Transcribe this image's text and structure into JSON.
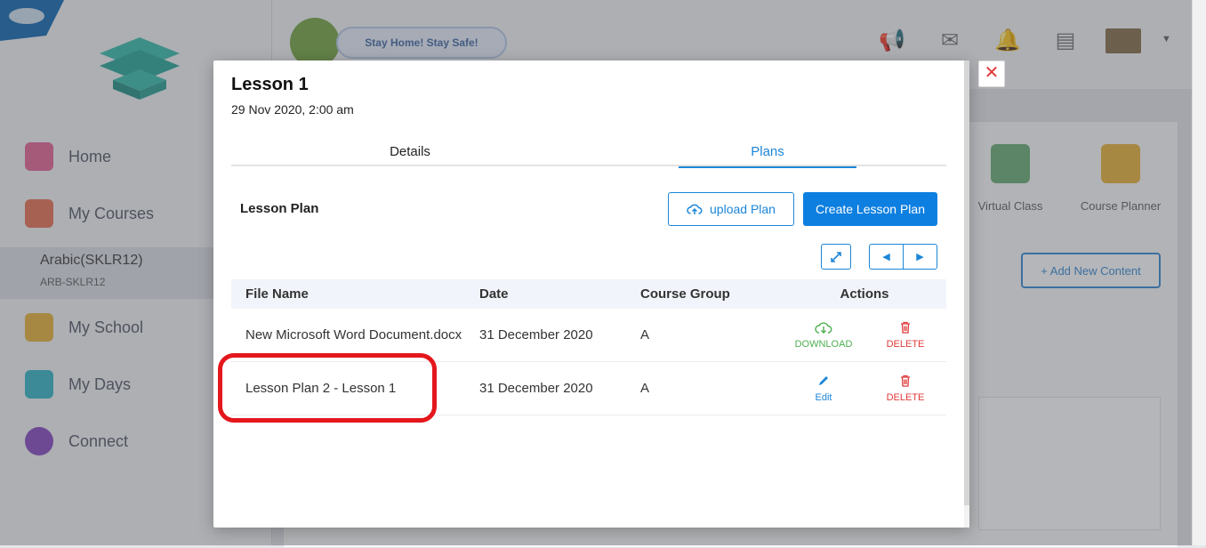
{
  "background": {
    "sidebar": {
      "nav": [
        {
          "label": "Home"
        },
        {
          "label": "My Courses"
        },
        {
          "label": "My School"
        },
        {
          "label": "My Days"
        },
        {
          "label": "Connect"
        }
      ],
      "active_course": {
        "name": "Arabic(SKLR12)",
        "code": "ARB-SKLR12"
      }
    },
    "topbar": {
      "banner_label": "Stay Home! Stay Safe!"
    },
    "tools": [
      {
        "label": "Virtual Class"
      },
      {
        "label": "Course Planner"
      }
    ],
    "add_content_label": "+ Add New Content"
  },
  "modal": {
    "title": "Lesson 1",
    "datetime": "29 Nov 2020, 2:00 am",
    "close_glyph": "✕",
    "tabs": [
      {
        "label": "Details",
        "active": false
      },
      {
        "label": "Plans",
        "active": true
      }
    ],
    "lesson_plan_label": "Lesson Plan",
    "upload_label": "upload Plan",
    "create_label": "Create Lesson Plan",
    "table": {
      "headers": {
        "file_name": "File Name",
        "date": "Date",
        "group": "Course Group",
        "actions": "Actions"
      },
      "rows": [
        {
          "file_name": "New Microsoft Word Document.docx",
          "date": "31 December 2020",
          "group": "A",
          "primary_action": "DOWNLOAD",
          "primary_icon": "download-icon",
          "delete": "DELETE"
        },
        {
          "file_name": "Lesson Plan 2 - Lesson 1",
          "date": "31 December 2020",
          "group": "A",
          "primary_action": "Edit",
          "primary_icon": "pencil-icon",
          "delete": "DELETE"
        }
      ]
    }
  },
  "colors": {
    "accent": "#0d7fe0",
    "danger": "#e03a3a",
    "success": "#4caf50",
    "highlight": "#e4171c"
  }
}
